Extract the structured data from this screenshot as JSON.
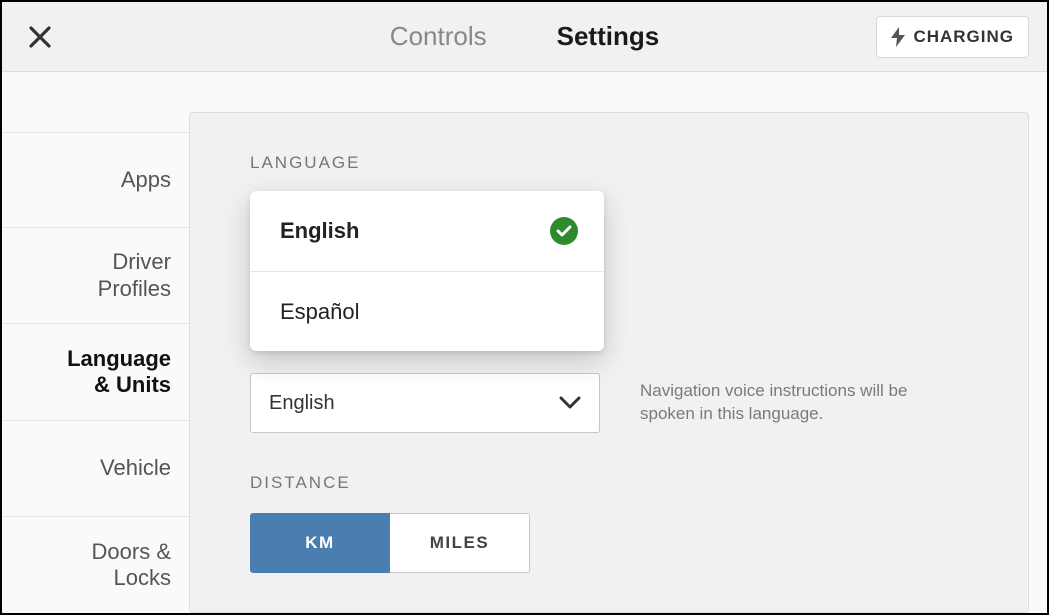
{
  "header": {
    "tab_controls": "Controls",
    "tab_settings": "Settings",
    "charging_label": "CHARGING"
  },
  "sidebar": {
    "items": [
      {
        "label": "Apps"
      },
      {
        "label_line1": "Driver",
        "label_line2": "Profiles"
      },
      {
        "label_line1": "Language",
        "label_line2": "& Units"
      },
      {
        "label": "Vehicle"
      },
      {
        "label_line1": "Doors &",
        "label_line2": "Locks"
      }
    ]
  },
  "main": {
    "language_section_label": "LANGUAGE",
    "language_dropdown": {
      "options": [
        {
          "label": "English",
          "selected": true
        },
        {
          "label": "Español",
          "selected": false
        }
      ]
    },
    "nav_language_value": "English",
    "nav_description": "Navigation voice instructions will be spoken in this language.",
    "distance_section_label": "DISTANCE",
    "distance": {
      "km_label": "KM",
      "miles_label": "MILES",
      "selected": "KM"
    }
  }
}
